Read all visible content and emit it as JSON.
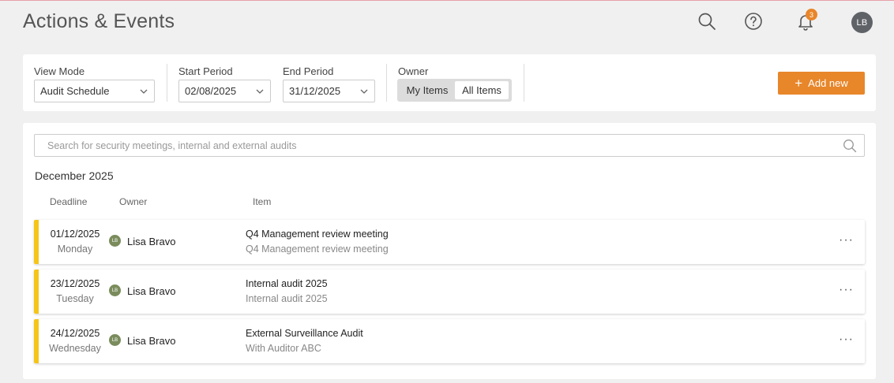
{
  "header": {
    "title": "Actions & Events",
    "notification_count": "3",
    "user_initials": "LB",
    "icons": [
      "search-icon",
      "help-icon",
      "bell-icon"
    ]
  },
  "filters": {
    "view_mode": {
      "label": "View Mode",
      "value": "Audit Schedule"
    },
    "start_period": {
      "label": "Start Period",
      "value": "02/08/2025"
    },
    "end_period": {
      "label": "End Period",
      "value": "31/12/2025"
    },
    "owner": {
      "label": "Owner",
      "options": [
        "My Items",
        "All Items"
      ],
      "selected": "All Items"
    },
    "add_new": "Add new"
  },
  "search": {
    "placeholder": "Search for security meetings, internal and external audits"
  },
  "list": {
    "month": "December 2025",
    "columns": {
      "deadline": "Deadline",
      "owner": "Owner",
      "item": "Item"
    },
    "rows": [
      {
        "date": "01/12/2025",
        "day": "Monday",
        "owner_initials": "LB",
        "owner": "Lisa Bravo",
        "title": "Q4 Management review meeting",
        "subtitle": "Q4 Management review meeting"
      },
      {
        "date": "23/12/2025",
        "day": "Tuesday",
        "owner_initials": "LB",
        "owner": "Lisa Bravo",
        "title": "Internal audit 2025",
        "subtitle": "Internal audit 2025"
      },
      {
        "date": "24/12/2025",
        "day": "Wednesday",
        "owner_initials": "LB",
        "owner": "Lisa Bravo",
        "title": "External Surveillance Audit",
        "subtitle": "With Auditor ABC"
      }
    ],
    "more_label": "···"
  },
  "colors": {
    "accent": "#e8862a",
    "row_marker": "#f5c518",
    "owner_avatar": "#7a8c5c",
    "user_avatar": "#5f6368"
  }
}
